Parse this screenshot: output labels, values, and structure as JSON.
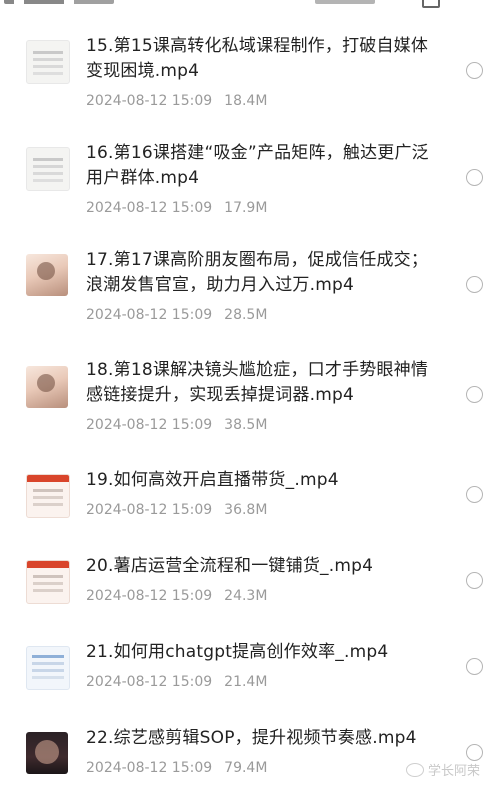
{
  "files": [
    {
      "title_line1": "15.第15课高转化私域课程制作，打破自媒体",
      "title_line2": "变现困境.mp4",
      "date": "2024-08-12 15:09",
      "size": "18.4M",
      "thumb": "doc"
    },
    {
      "title_line1": "16.第16课搭建“吸金”产品矩阵，触达更广泛",
      "title_line2": "用户群体.mp4",
      "date": "2024-08-12 15:09",
      "size": "17.9M",
      "thumb": "doc"
    },
    {
      "title_line1": "17.第17课高阶朋友圈布局，促成信任成交；",
      "title_line2": "浪潮发售官宣，助力月入过万.mp4",
      "date": "2024-08-12 15:09",
      "size": "28.5M",
      "thumb": "photo"
    },
    {
      "title_line1": "18.第18课解决镜头尴尬症，口才手势眼神情",
      "title_line2": "感链接提升，实现丢掉提词器.mp4",
      "date": "2024-08-12 15:09",
      "size": "38.5M",
      "thumb": "photo"
    },
    {
      "title_line1": "19.如何高效开启直播带货_.mp4",
      "title_line2": "",
      "date": "2024-08-12 15:09",
      "size": "36.8M",
      "thumb": "red"
    },
    {
      "title_line1": "20.薯店运营全流程和一键铺货_.mp4",
      "title_line2": "",
      "date": "2024-08-12 15:09",
      "size": "24.3M",
      "thumb": "red"
    },
    {
      "title_line1": "21.如何用chatgpt提高创作效率_.mp4",
      "title_line2": "",
      "date": "2024-08-12 15:09",
      "size": "21.4M",
      "thumb": "blue"
    },
    {
      "title_line1": "22.综艺感剪辑SOP，提升视频节奏感.mp4",
      "title_line2": "",
      "date": "2024-08-12 15:09",
      "size": "79.4M",
      "thumb": "dark"
    }
  ],
  "watermark": "学长阿荣",
  "icons": {
    "thumbnail": "video-thumbnail-icon",
    "select": "radio-circle-icon",
    "view": "grid-view-icon",
    "watermark": "weibo-icon"
  }
}
